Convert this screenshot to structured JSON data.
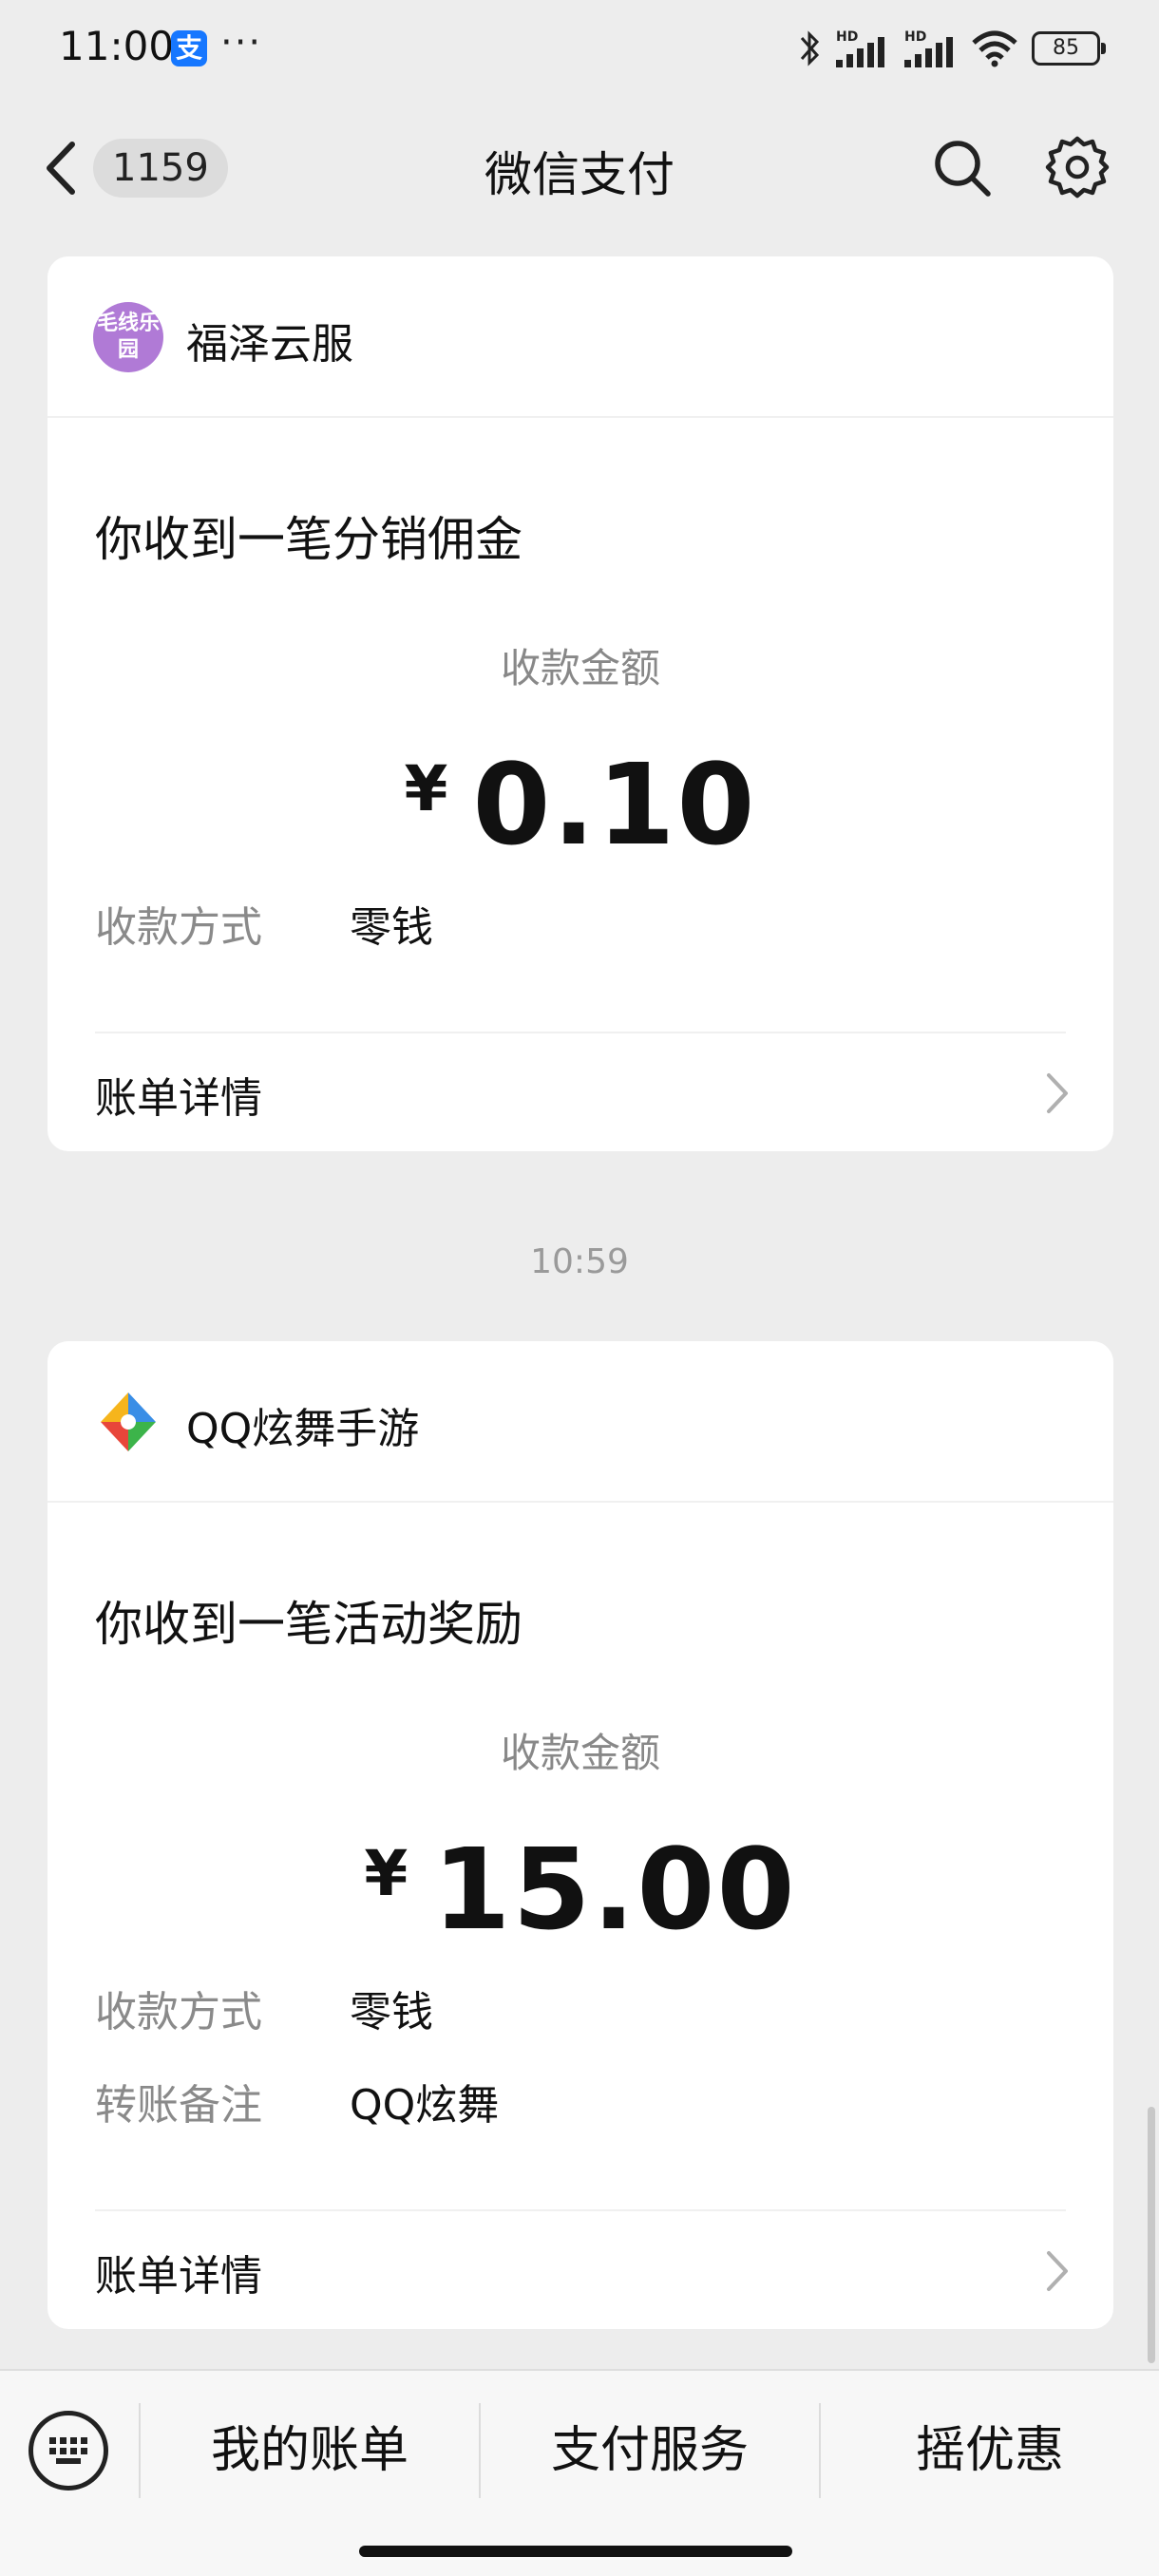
{
  "status_bar": {
    "time": "11:00",
    "alipay_glyph": "支",
    "more": "···",
    "battery": "85",
    "icons": [
      "bluetooth-icon",
      "signal-hd-icon",
      "signal-hd-icon",
      "wifi-icon",
      "battery-icon"
    ]
  },
  "nav": {
    "unread_count": "1159",
    "title": "微信支付",
    "icons": [
      "back-icon",
      "search-icon",
      "gear-icon"
    ]
  },
  "messages": [
    {
      "merchant": "福泽云服",
      "logo_text": "毛线乐园",
      "title": "你收到一笔分销佣金",
      "amount_label": "收款金额",
      "currency": "¥",
      "amount": "0.10",
      "fields": [
        {
          "label": "收款方式",
          "value": "零钱"
        }
      ],
      "detail_link": "账单详情"
    },
    {
      "timestamp": "10:59",
      "merchant": "QQ炫舞手游",
      "title": "你收到一笔活动奖励",
      "amount_label": "收款金额",
      "currency": "¥",
      "amount": "15.00",
      "fields": [
        {
          "label": "收款方式",
          "value": "零钱"
        },
        {
          "label": "转账备注",
          "value": "QQ炫舞"
        }
      ],
      "detail_link": "账单详情"
    }
  ],
  "bottom_menu": {
    "items": [
      "我的账单",
      "支付服务",
      "摇优惠"
    ]
  },
  "colors": {
    "background": "#ededed",
    "card": "#ffffff",
    "muted_text": "#888888",
    "alipay_blue": "#1677ff"
  }
}
